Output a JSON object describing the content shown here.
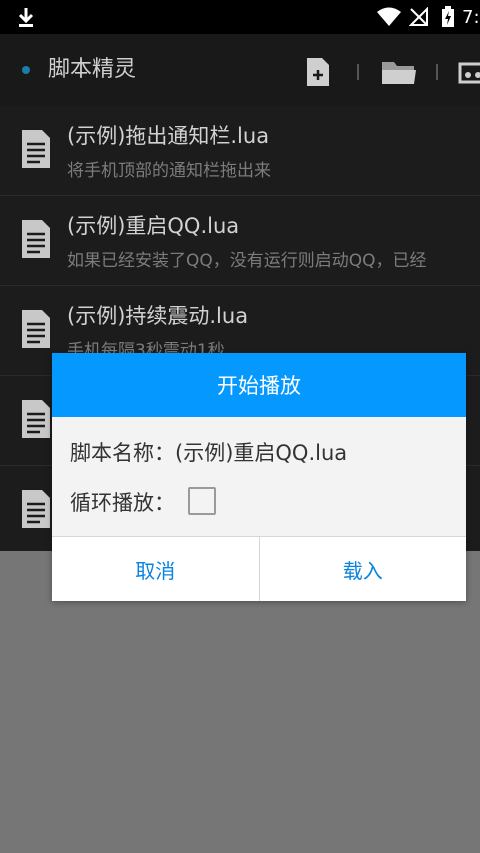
{
  "status_bar": {
    "time": "7:"
  },
  "app_bar": {
    "title": "脚本精灵"
  },
  "scripts": [
    {
      "name": "(示例)拖出通知栏.lua",
      "desc": "将手机顶部的通知栏拖出来"
    },
    {
      "name": "(示例)重启QQ.lua",
      "desc": "如果已经安装了QQ，没有运行则启动QQ，已经"
    },
    {
      "name": "(示例)持续震动.lua",
      "desc": "手机每隔3秒震动1秒"
    },
    {
      "name": "",
      "desc": ""
    },
    {
      "name": "",
      "desc": ""
    }
  ],
  "dialog": {
    "title": "开始播放",
    "script_label": "脚本名称：(示例)重启QQ.lua",
    "loop_label": "循环播放：",
    "loop_checked": false,
    "cancel": "取消",
    "load": "载入"
  },
  "colors": {
    "accent": "#0598ff",
    "button_text": "#0a84e0"
  }
}
